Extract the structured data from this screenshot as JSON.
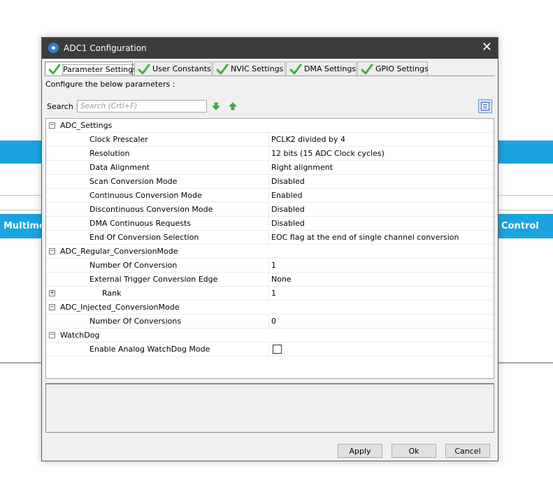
{
  "background": {
    "left_label": "Multime",
    "right_label": "Control"
  },
  "dialog": {
    "title": "ADC1 Configuration",
    "close_glyph": "✕",
    "tabs": [
      {
        "label": "Parameter Settings",
        "active": true
      },
      {
        "label": "User Constants",
        "active": false
      },
      {
        "label": "NVIC Settings",
        "active": false
      },
      {
        "label": "DMA Settings",
        "active": false
      },
      {
        "label": "GPIO Settings",
        "active": false
      }
    ],
    "instructions": "Configure the below parameters :",
    "search": {
      "label": "Search :",
      "placeholder": "Search (Crtl+F)"
    },
    "groups": {
      "adc_settings": {
        "title": "ADC_Settings",
        "params": [
          {
            "name": "Clock Prescaler",
            "value": "PCLK2 divided by 4"
          },
          {
            "name": "Resolution",
            "value": "12 bits (15 ADC Clock cycles)"
          },
          {
            "name": "Data Alignment",
            "value": "Right alignment"
          },
          {
            "name": "Scan Conversion Mode",
            "value": "Disabled"
          },
          {
            "name": "Continuous Conversion Mode",
            "value": "Enabled"
          },
          {
            "name": "Discontinuous Conversion Mode",
            "value": "Disabled"
          },
          {
            "name": "DMA Continuous Requests",
            "value": "Disabled"
          },
          {
            "name": "End Of Conversion Selection",
            "value": "EOC flag at the end of single channel conversion"
          }
        ]
      },
      "regular": {
        "title": "ADC_Regular_ConversionMode",
        "params": [
          {
            "name": "Number Of Conversion",
            "value": "1"
          },
          {
            "name": "External Trigger Conversion Edge",
            "value": "None"
          },
          {
            "name": "Rank",
            "value": "1"
          }
        ]
      },
      "injected": {
        "title": "ADC_Injected_ConversionMode",
        "params": [
          {
            "name": "Number Of Conversions",
            "value": "0"
          }
        ]
      },
      "watchdog": {
        "title": "WatchDog",
        "params": [
          {
            "name": "Enable Analog WatchDog Mode",
            "checked": false
          }
        ]
      }
    },
    "buttons": {
      "apply": "Apply",
      "ok": "Ok",
      "cancel": "Cancel"
    }
  },
  "colors": {
    "accent_blue": "#1ba3e0",
    "titlebar": "#3c3c3c",
    "check_green": "#3cb43c"
  }
}
